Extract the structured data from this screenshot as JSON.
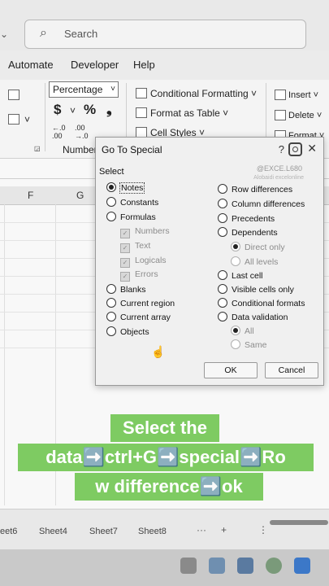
{
  "search": {
    "icon": "search-icon",
    "placeholder": "Search"
  },
  "ribbon_tabs": [
    "Automate",
    "Developer",
    "Help"
  ],
  "ribbon": {
    "number_format": "Percentage",
    "currency_symbol": "$",
    "percent_symbol": "%",
    "comma_symbol": "❟",
    "number_group_label": "Number",
    "conditional_formatting": "Conditional Formatting ˅",
    "format_as_table": "Format as Table ˅",
    "cell_styles": "Cell Styles ˅",
    "insert": "Insert ˅",
    "delete": "Delete ˅",
    "format": "Format ˅"
  },
  "columns": [
    "F",
    "G"
  ],
  "dialog": {
    "title": "Go To Special",
    "help": "?",
    "close": "✕",
    "watermark": "@EXCE.L680",
    "watermark_small": "Alobaidi excelonline",
    "group_label": "Select",
    "left_options": [
      {
        "label": "Notes",
        "selected": true
      },
      {
        "label": "Constants",
        "selected": false
      },
      {
        "label": "Formulas",
        "selected": false
      }
    ],
    "formula_subs": [
      "Numbers",
      "Text",
      "Logicals",
      "Errors"
    ],
    "left_options_2": [
      "Blanks",
      "Current region",
      "Current array",
      "Objects"
    ],
    "right_options": [
      "Row differences",
      "Column differences",
      "Precedents",
      "Dependents"
    ],
    "dependents_subs": [
      "Direct only",
      "All levels"
    ],
    "right_options_2": [
      "Last cell",
      "Visible cells only",
      "Conditional formats",
      "Data validation"
    ],
    "validation_subs": [
      "All",
      "Same"
    ],
    "ok_label": "OK",
    "cancel_label": "Cancel"
  },
  "caption": {
    "line1": "Select the",
    "line2": "data➡️ctrl+G➡️special➡️Ro",
    "line3": "w difference➡️ok"
  },
  "sheet_tabs": [
    "eet6",
    "Sheet4",
    "Sheet7",
    "Sheet8"
  ],
  "sheet_controls": {
    "more": "···",
    "add": "+",
    "divider": "⋮"
  }
}
